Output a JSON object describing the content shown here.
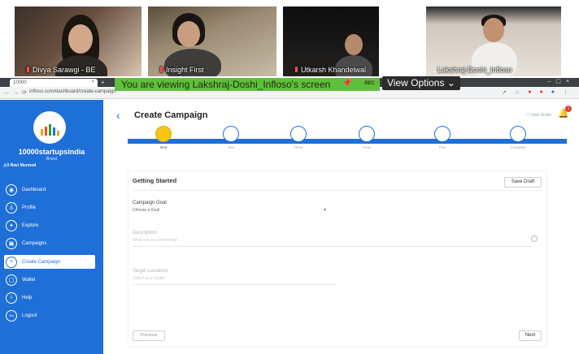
{
  "video": {
    "tiles": [
      {
        "name": "Divya Sarawgi - BE"
      },
      {
        "name": "Insight First"
      },
      {
        "name": "Utkarsh Khandelwal"
      },
      {
        "name": "Lakshraj-Doshi_Infloso"
      }
    ]
  },
  "share": {
    "banner": "You are viewing Lakshraj-Doshi_Infloso's screen",
    "rec": "REC",
    "view_options": "View Options ⌄"
  },
  "browser": {
    "tab_title": "10000",
    "url": "infloso.com/dashboard/create-campaign"
  },
  "sidebar": {
    "brand": "10000startupsindia",
    "brand_sub": "Brand",
    "user": "Ravi Murmod",
    "items": [
      {
        "label": "Dashboard",
        "icon": "dashboard-icon",
        "glyph": "◉"
      },
      {
        "label": "Profile",
        "icon": "user-icon",
        "glyph": "♙"
      },
      {
        "label": "Explore",
        "icon": "explore-icon",
        "glyph": "✦"
      },
      {
        "label": "Campaigns",
        "icon": "campaigns-icon",
        "glyph": "▣"
      },
      {
        "label": "Create Campaign",
        "icon": "plus-icon",
        "glyph": "+"
      },
      {
        "label": "Wallet",
        "icon": "wallet-icon",
        "glyph": "▢"
      },
      {
        "label": "Help",
        "icon": "help-icon",
        "glyph": "i"
      },
      {
        "label": "Logout",
        "icon": "logout-icon",
        "glyph": "⇦"
      }
    ]
  },
  "main": {
    "title": "Create Campaign",
    "view_drafts": "View Drafts",
    "notification_count": "1",
    "steps": [
      "One",
      "Two",
      "Three",
      "Four",
      "Five",
      "Complete"
    ],
    "current_step": 0,
    "card_title": "Getting Started",
    "save_draft": "Save Draft",
    "campaign_goal_label": "Campaign Goal",
    "campaign_goal_value": "Choose a Goal",
    "description_label": "Description",
    "description_placeholder": "What are you promoting?",
    "target_label": "Target Locations",
    "target_placeholder": "Select your target",
    "previous": "Previous",
    "next": "Next"
  },
  "colors": {
    "accent": "#1f6fd8",
    "step_current": "#f5c518",
    "share_banner": "#5fbf3a"
  }
}
